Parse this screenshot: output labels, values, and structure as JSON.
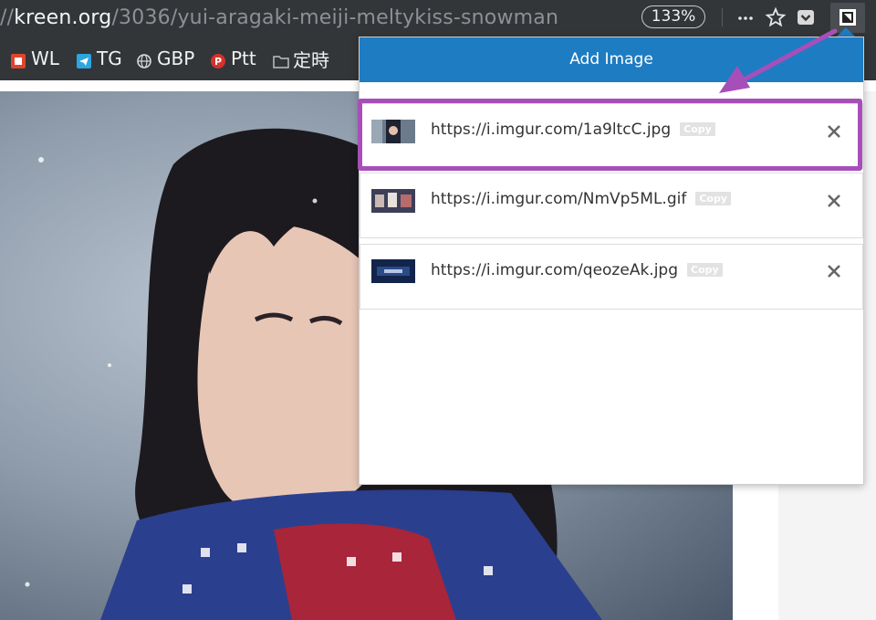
{
  "browser": {
    "url_prefix": "//",
    "url_host": "kreen.org",
    "url_path": "/3036/yui-aragaki-meiji-meltykiss-snowman",
    "zoom_level": "133%",
    "icons": [
      "more-icon",
      "star-icon",
      "pocket-icon",
      "extension-icon"
    ]
  },
  "bookmarks": [
    {
      "label": "WL",
      "icon": "wl-favicon",
      "color": "#e0452b"
    },
    {
      "label": "TG",
      "icon": "tg-favicon",
      "color": "#2ca5e0"
    },
    {
      "label": "GBP",
      "icon": "globe-icon",
      "color": "#d9d9d9"
    },
    {
      "label": "Ptt",
      "icon": "ptt-favicon",
      "color": "#d6322a"
    },
    {
      "label": "定時",
      "icon": "folder-icon",
      "color": "#bfbfbf"
    }
  ],
  "popup": {
    "title": "Add Image",
    "header_color": "#1e7cc3",
    "items": [
      {
        "url": "https://i.imgur.com/1a9ltcC.jpg",
        "copy_label": "Copy",
        "thumb": "thumb-portrait"
      },
      {
        "url": "https://i.imgur.com/NmVp5ML.gif",
        "copy_label": "Copy",
        "thumb": "thumb-crowd"
      },
      {
        "url": "https://i.imgur.com/qeozeAk.jpg",
        "copy_label": "Copy",
        "thumb": "thumb-screen"
      }
    ]
  },
  "annotation": {
    "highlight_color": "#a74fb9"
  }
}
